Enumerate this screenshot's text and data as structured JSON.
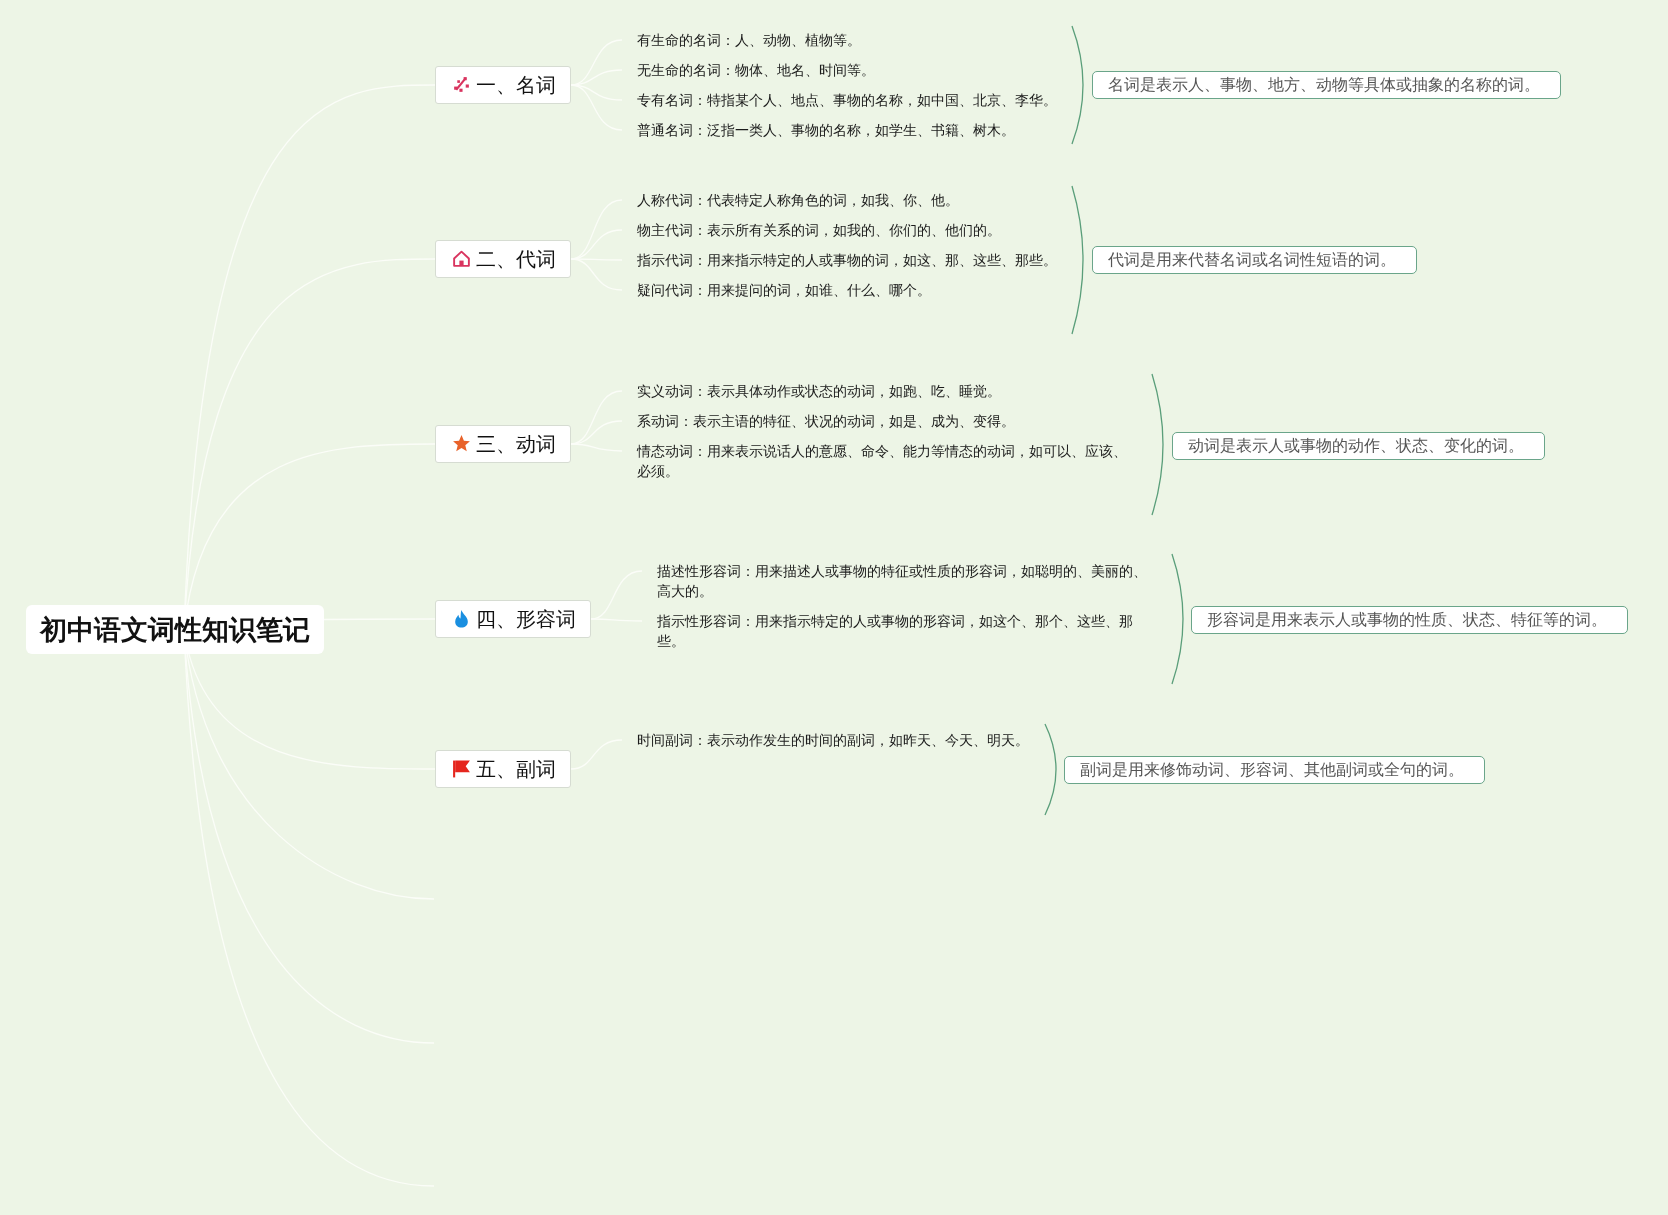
{
  "title": "初中语文词性知识笔记",
  "topics": [
    {
      "label": "一、名词",
      "items": [
        "有生命的名词：人、动物、植物等。",
        "无生命的名词：物体、地名、时间等。",
        "专有名词：特指某个人、地点、事物的名称，如中国、北京、李华。",
        "普通名词：泛指一类人、事物的名称，如学生、书籍、树木。"
      ],
      "summary": "名词是表示人、事物、地方、动物等具体或抽象的名称的词。"
    },
    {
      "label": "二、代词",
      "items": [
        "人称代词：代表特定人称角色的词，如我、你、他。",
        "物主代词：表示所有关系的词，如我的、你们的、他们的。",
        "指示代词：用来指示特定的人或事物的词，如这、那、这些、那些。",
        "疑问代词：用来提问的词，如谁、什么、哪个。"
      ],
      "summary": "代词是用来代替名词或名词性短语的词。"
    },
    {
      "label": "三、动词",
      "items": [
        "实义动词：表示具体动作或状态的动词，如跑、吃、睡觉。",
        "系动词：表示主语的特征、状况的动词，如是、成为、变得。",
        "情态动词：用来表示说话人的意愿、命令、能力等情态的动词，如可以、应该、必须。"
      ],
      "summary": "动词是表示人或事物的动作、状态、变化的词。"
    },
    {
      "label": "四、形容词",
      "items": [
        "描述性形容词：用来描述人或事物的特征或性质的形容词，如聪明的、美丽的、高大的。",
        "指示性形容词：用来指示特定的人或事物的形容词，如这个、那个、这些、那些。"
      ],
      "summary": "形容词是用来表示人或事物的性质、状态、特征等的词。"
    },
    {
      "label": "五、副词",
      "items": [
        "时间副词：表示动作发生的时间的副词，如昨天、今天、明天。"
      ],
      "summary": "副词是用来修饰动词、形容词、其他副词或全句的词。"
    }
  ]
}
